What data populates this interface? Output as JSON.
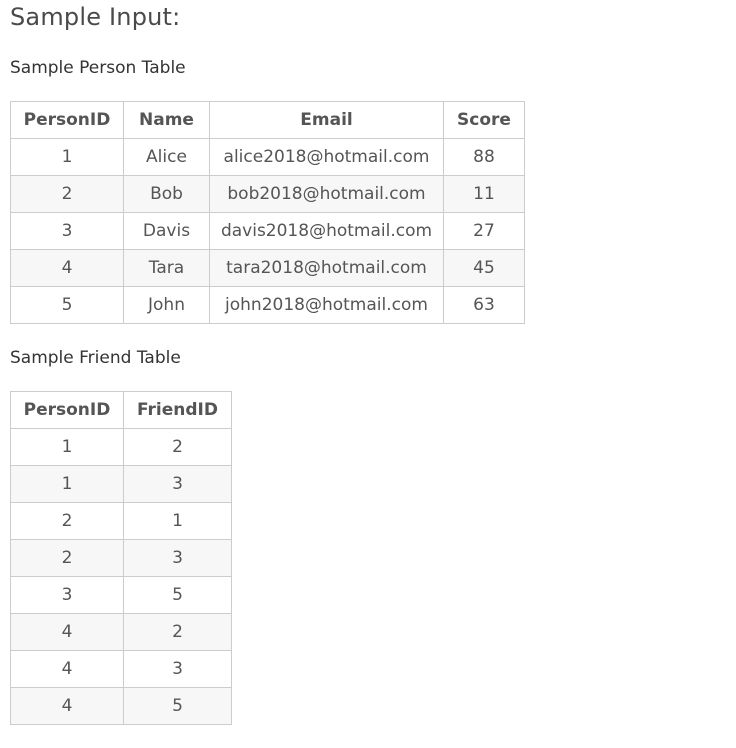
{
  "page_title": "Sample Input:",
  "person_table": {
    "title": "Sample Person Table",
    "headers": [
      "PersonID",
      "Name",
      "Email",
      "Score"
    ],
    "rows": [
      [
        "1",
        "Alice",
        "alice2018@hotmail.com",
        "88"
      ],
      [
        "2",
        "Bob",
        "bob2018@hotmail.com",
        "11"
      ],
      [
        "3",
        "Davis",
        "davis2018@hotmail.com",
        "27"
      ],
      [
        "4",
        "Tara",
        "tara2018@hotmail.com",
        "45"
      ],
      [
        "5",
        "John",
        "john2018@hotmail.com",
        "63"
      ]
    ]
  },
  "friend_table": {
    "title": "Sample Friend Table",
    "headers": [
      "PersonID",
      "FriendID"
    ],
    "rows": [
      [
        "1",
        "2"
      ],
      [
        "1",
        "3"
      ],
      [
        "2",
        "1"
      ],
      [
        "2",
        "3"
      ],
      [
        "3",
        "5"
      ],
      [
        "4",
        "2"
      ],
      [
        "4",
        "3"
      ],
      [
        "4",
        "5"
      ]
    ]
  }
}
